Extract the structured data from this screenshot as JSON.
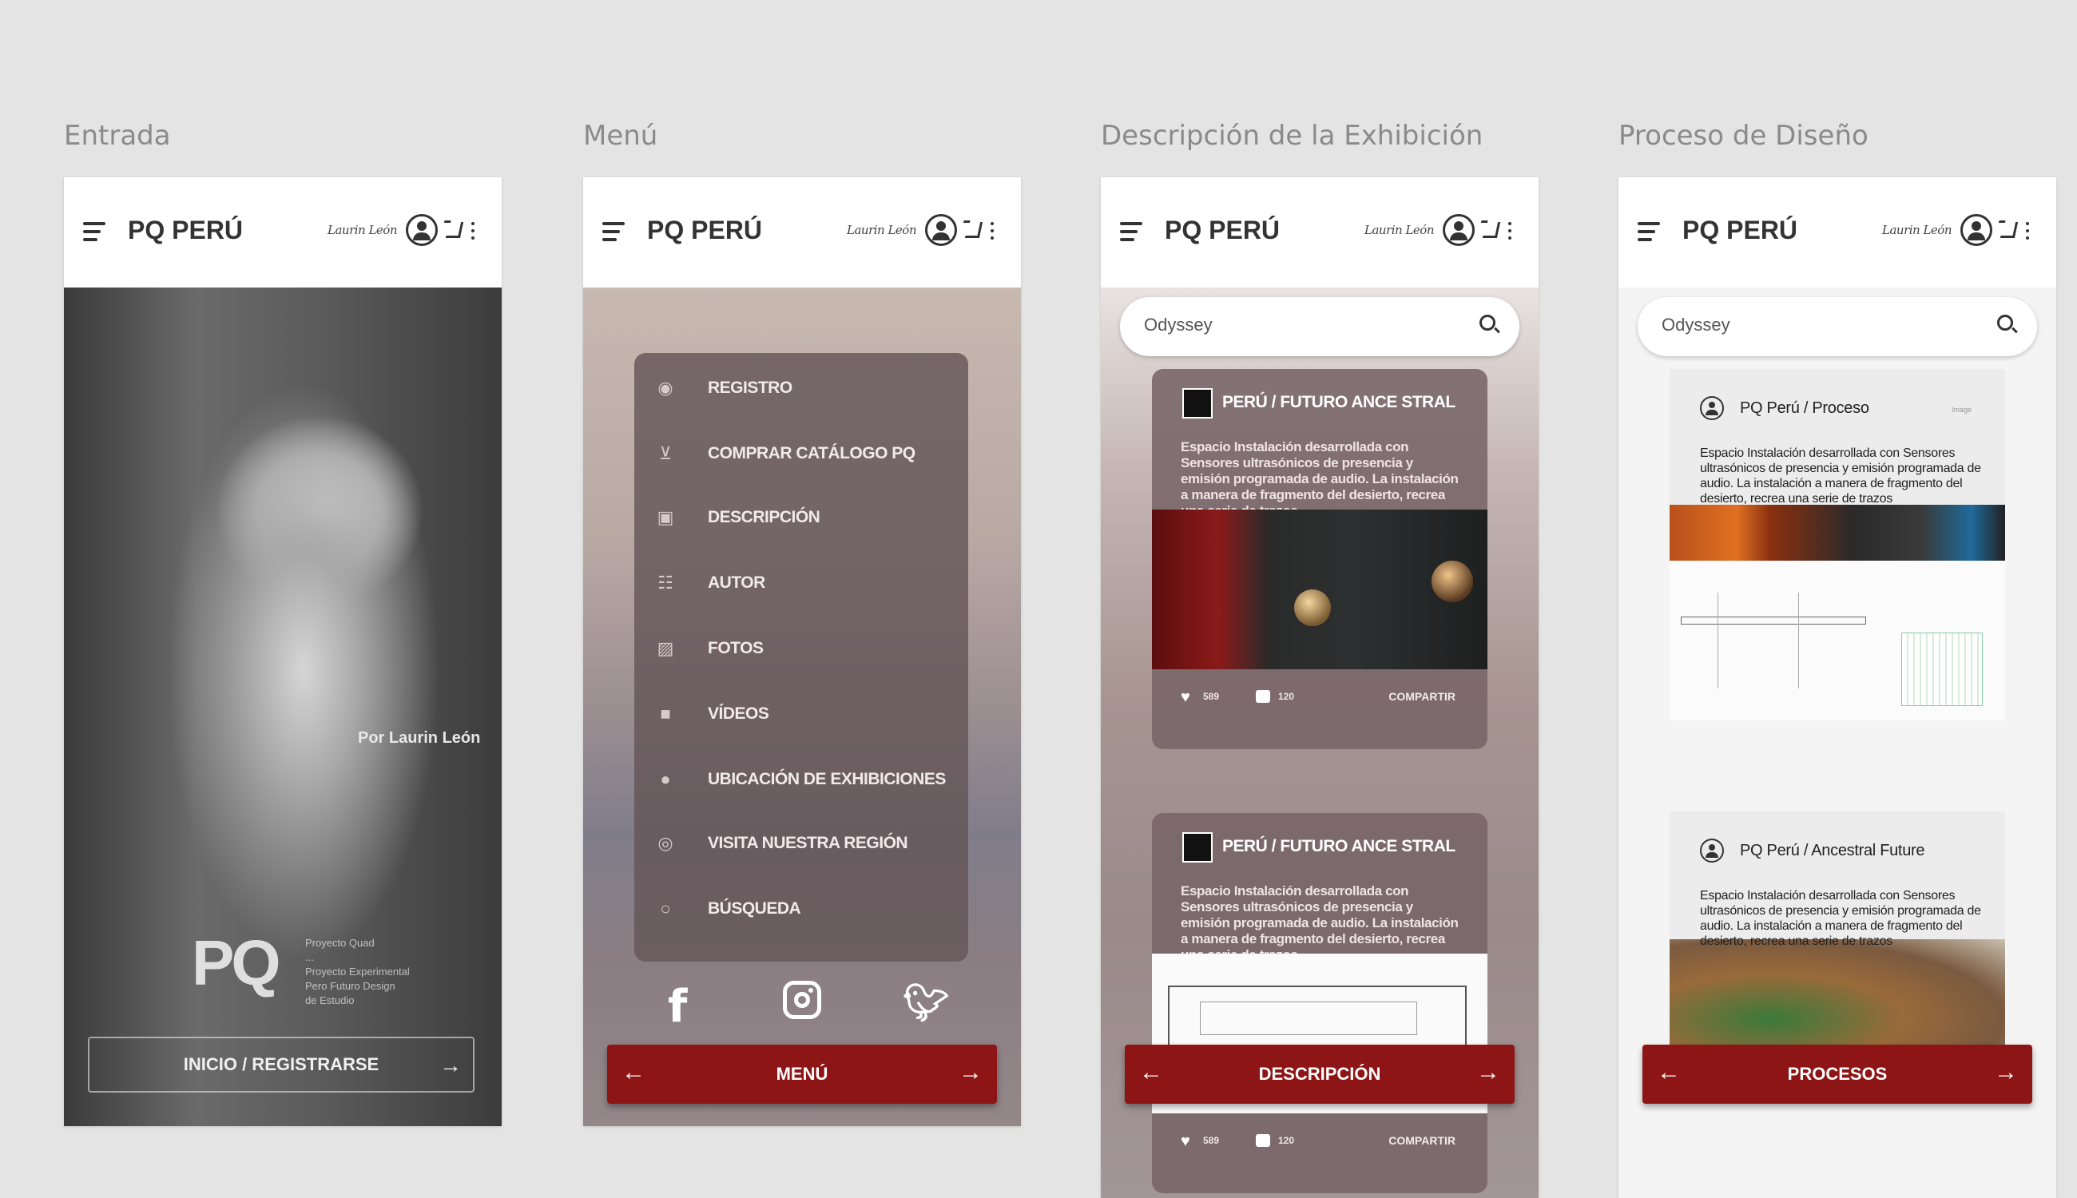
{
  "boards": [
    {
      "title": "Entrada"
    },
    {
      "title": "Menú"
    },
    {
      "title": "Descripción de la Exhibición"
    },
    {
      "title": "Proceso de Diseño"
    }
  ],
  "appbar": {
    "title": "PQ PERÚ",
    "signature": "Laurin León"
  },
  "entrada": {
    "author": "Por Laurin León",
    "logo": "PQ",
    "logo_lines": [
      "Proyecto Quad",
      "...",
      "Proyecto Experimental",
      "Pero Futuro Design",
      "de Estudio"
    ],
    "button": "INICIO / REGISTRARSE"
  },
  "menu": {
    "items": [
      {
        "label": "REGISTRO",
        "icon": "account-icon"
      },
      {
        "label": "COMPRAR CATÁLOGO PQ",
        "icon": "cart-icon"
      },
      {
        "label": "DESCRIPCIÓN",
        "icon": "image-icon"
      },
      {
        "label": "AUTOR",
        "icon": "list-icon"
      },
      {
        "label": "FOTOS",
        "icon": "photo-icon"
      },
      {
        "label": "VÍDEOS",
        "icon": "video-icon"
      },
      {
        "label": "UBICACIÓN DE EXHIBICIONES",
        "icon": "location-icon"
      },
      {
        "label": "VISITA NUESTRA REGIÓN",
        "icon": "globe-icon"
      },
      {
        "label": "BÚSQUEDA",
        "icon": "search-icon"
      }
    ],
    "social": [
      "facebook-icon",
      "instagram-icon",
      "twitter-icon"
    ],
    "button": "MENÚ"
  },
  "descripcion": {
    "search_value": "Odyssey",
    "posts": [
      {
        "title": "PERÚ / FUTURO ANCE STRAL",
        "text": "Espacio Instalación desarrollada con Sensores ultrasónicos de presencia y emisión programada de audio. La instalación a manera de fragmento del desierto, recrea una serie de trazos",
        "likes": "589",
        "comments": "120",
        "share": "COMPARTIR"
      },
      {
        "title": "PERÚ / FUTURO ANCE STRAL",
        "text": "Espacio Instalación desarrollada con Sensores ultrasónicos de presencia y emisión programada de audio. La instalación a manera de fragmento del desierto, recrea una serie de trazos",
        "likes": "589",
        "comments": "120",
        "share": "COMPARTIR"
      }
    ],
    "button": "DESCRIPCIÓN"
  },
  "proceso": {
    "search_value": "Odyssey",
    "posts": [
      {
        "title": "PQ Perú / Proceso",
        "tag": "Image",
        "text": "Espacio Instalación desarrollada con Sensores ultrasónicos de presencia y emisión programada de audio. La instalación a manera de fragmento del desierto, recrea una serie de trazos"
      },
      {
        "title": "PQ Perú / Ancestral Future",
        "text": "Espacio Instalación desarrollada con Sensores ultrasónicos de presencia y emisión programada de audio. La instalación a manera de fragmento del desierto, recrea una serie de trazos"
      }
    ],
    "button": "PROCESOS"
  },
  "colors": {
    "accent_red": "#8e1515",
    "background": "#e4e4e4"
  }
}
